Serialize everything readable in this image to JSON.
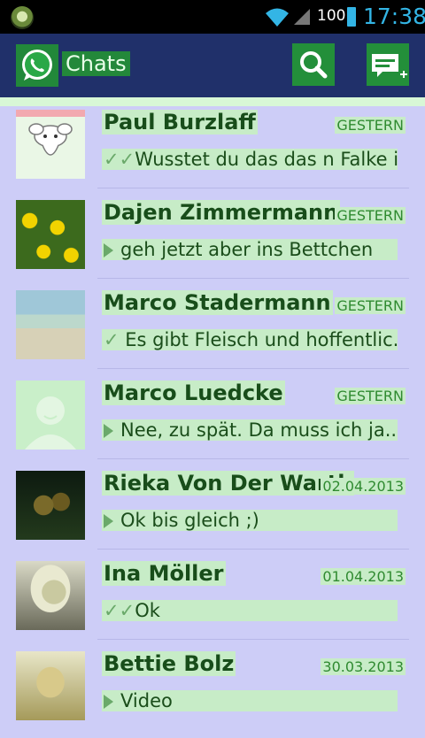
{
  "status_bar": {
    "battery_percent": "100",
    "time": "17:38",
    "icons": [
      "app-notification-icon",
      "wifi-icon",
      "signal-icon",
      "battery-icon"
    ]
  },
  "action_bar": {
    "title": "Chats",
    "search_icon": "search-icon",
    "new_chat_icon": "new-chat-icon"
  },
  "chats": [
    {
      "name": "Paul Burzlaff",
      "date": "GESTERN",
      "status": "double-check",
      "message": "Wusstet du das das n Falke i..."
    },
    {
      "name": "Dajen Zimmermann",
      "date": "GESTERN",
      "status": "play",
      "message": "geh jetzt aber ins Bettchen"
    },
    {
      "name": "Marco Stadermann",
      "date": "GESTERN",
      "status": "check",
      "message": "Es gibt Fleisch und hoffentlic..."
    },
    {
      "name": "Marco Luedcke",
      "date": "GESTERN",
      "status": "play",
      "message": "Nee, zu spät.  Da muss ich ja..."
    },
    {
      "name": "Rieka Von Der Warth",
      "date": "02.04.2013",
      "status": "play",
      "message": "Ok bis gleich ;)"
    },
    {
      "name": "Ina Möller",
      "date": "01.04.2013",
      "status": "double-check",
      "message": "Ok"
    },
    {
      "name": "Bettie Bolz",
      "date": "30.03.2013",
      "status": "play",
      "message": "Video"
    }
  ]
}
